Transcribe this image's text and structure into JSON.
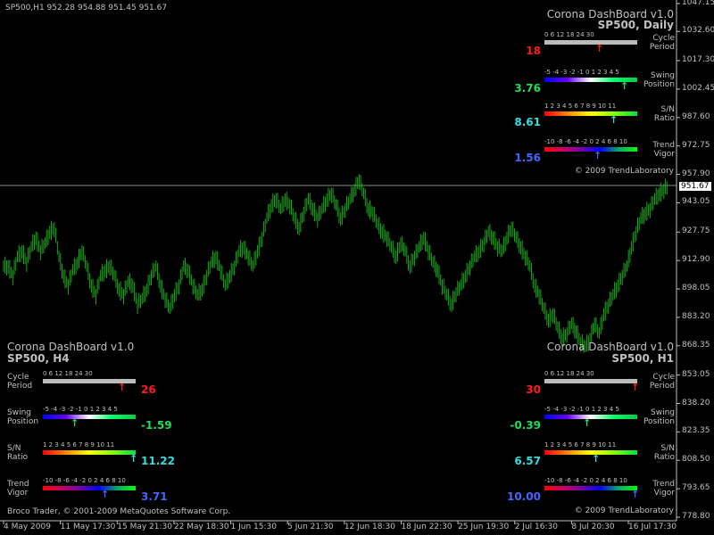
{
  "header": {
    "text": "SP500,H1  952.28 954.88 951.45 951.67"
  },
  "colors": {
    "candle": "#1aa51a",
    "axis": "#c0c0c0",
    "grid": "#8c8c8c",
    "red": "#ff1a1a",
    "green": "#22dd55",
    "cyan": "#33dddd",
    "blue": "#4466ff"
  },
  "y_axis": [
    "1047.15",
    "1032.60",
    "1017.30",
    "1002.45",
    "987.60",
    "972.75",
    "957.90",
    "943.05",
    "927.75",
    "912.90",
    "898.05",
    "883.20",
    "868.35",
    "853.05",
    "838.20",
    "823.35",
    "808.50",
    "793.65",
    "778.80"
  ],
  "x_axis": [
    "4 May 2009",
    "11 May 17:30",
    "15 May 21:30",
    "22 May 18:30",
    "1 Jun 15:30",
    "5 Jun 21:30",
    "12 Jun 18:30",
    "18 Jun 22:30",
    "25 Jun 19:30",
    "2 Jul 16:30",
    "8 Jul 20:30",
    "16 Jul 17:30"
  ],
  "current_price": "951.67",
  "copyright_left": "Broco Trader, © 2001-2009 MetaQuotes Software Corp.",
  "panels": {
    "daily": {
      "title": "Corona DashBoard v1.0",
      "symbol": "SP500, Daily",
      "copyright": "© 2009 TrendLaboratory",
      "cycle": {
        "label1": "Cycle",
        "label2": "Period",
        "value": "18",
        "ticks": "0    6    12   18   24   30",
        "marker": 0.6
      },
      "swing": {
        "label1": "Swing",
        "label2": "Position",
        "value": "3.76",
        "ticks": "-5 -4 -3 -2 -1  0  1  2  3  4  5",
        "marker": 0.88
      },
      "sn": {
        "label1": "S/N",
        "label2": "Ratio",
        "value": "8.61",
        "ticks": "1  2  3  4  5  6  7  8  9 10 11",
        "marker": 0.76
      },
      "trend": {
        "label1": "Trend",
        "label2": "Vigor",
        "value": "1.56",
        "ticks": "-10 -8 -6 -4 -2  0  2  4  6  8 10",
        "marker": 0.58
      }
    },
    "h4": {
      "title": "Corona DashBoard v1.0",
      "symbol": "SP500, H4",
      "cycle": {
        "label1": "Cycle",
        "label2": "Period",
        "value": "26",
        "ticks": "0    6    12   18   24   30",
        "marker": 0.87
      },
      "swing": {
        "label1": "Swing",
        "label2": "Position",
        "value": "-1.59",
        "ticks": "-5 -4 -3 -2 -1  0  1  2  3  4  5",
        "marker": 0.34
      },
      "sn": {
        "label1": "S/N",
        "label2": "Ratio",
        "value": "11.22",
        "ticks": "1  2  3  4  5  6  7  8  9 10 11",
        "marker": 1.0
      },
      "trend": {
        "label1": "Trend",
        "label2": "Vigor",
        "value": "3.71",
        "ticks": "-10 -8 -6 -4 -2  0  2  4  6  8 10",
        "marker": 0.68
      }
    },
    "h1": {
      "title": "Corona DashBoard v1.0",
      "symbol": "SP500, H1",
      "copyright": "© 2009 TrendLaboratory",
      "cycle": {
        "label1": "Cycle",
        "label2": "Period",
        "value": "30",
        "ticks": "0    6    12   18   24   30",
        "marker": 1.0
      },
      "swing": {
        "label1": "Swing",
        "label2": "Position",
        "value": "-0.39",
        "ticks": "-5 -4 -3 -2 -1  0  1  2  3  4  5",
        "marker": 0.46
      },
      "sn": {
        "label1": "S/N",
        "label2": "Ratio",
        "value": "6.57",
        "ticks": "1  2  3  4  5  6  7  8  9 10 11",
        "marker": 0.56
      },
      "trend": {
        "label1": "Trend",
        "label2": "Vigor",
        "value": "10.00",
        "ticks": "-10 -8 -6 -4 -2  0  2  4  6  8 10",
        "marker": 1.0
      }
    }
  },
  "series_closes": [
    910,
    905,
    915,
    918,
    912,
    920,
    925,
    918,
    922,
    928,
    930,
    915,
    905,
    900,
    908,
    912,
    918,
    910,
    900,
    895,
    905,
    908,
    910,
    905,
    898,
    895,
    902,
    900,
    890,
    893,
    898,
    905,
    910,
    900,
    893,
    888,
    895,
    900,
    910,
    908,
    900,
    895,
    898,
    905,
    912,
    915,
    908,
    900,
    905,
    910,
    918,
    920,
    915,
    910,
    918,
    925,
    935,
    942,
    945,
    940,
    945,
    942,
    935,
    930,
    938,
    945,
    940,
    935,
    940,
    945,
    948,
    942,
    935,
    940,
    945,
    950,
    955,
    948,
    940,
    938,
    932,
    928,
    925,
    920,
    915,
    922,
    918,
    910,
    915,
    920,
    925,
    918,
    912,
    908,
    900,
    895,
    890,
    896,
    900,
    905,
    910,
    915,
    918,
    922,
    928,
    925,
    920,
    918,
    925,
    930,
    925,
    920,
    915,
    910,
    900,
    895,
    888,
    882,
    885,
    878,
    872,
    875,
    880,
    876,
    870,
    868,
    872,
    880,
    875,
    885,
    890,
    895,
    900,
    905,
    910,
    920,
    928,
    935,
    938,
    940,
    945,
    948,
    950,
    952
  ]
}
